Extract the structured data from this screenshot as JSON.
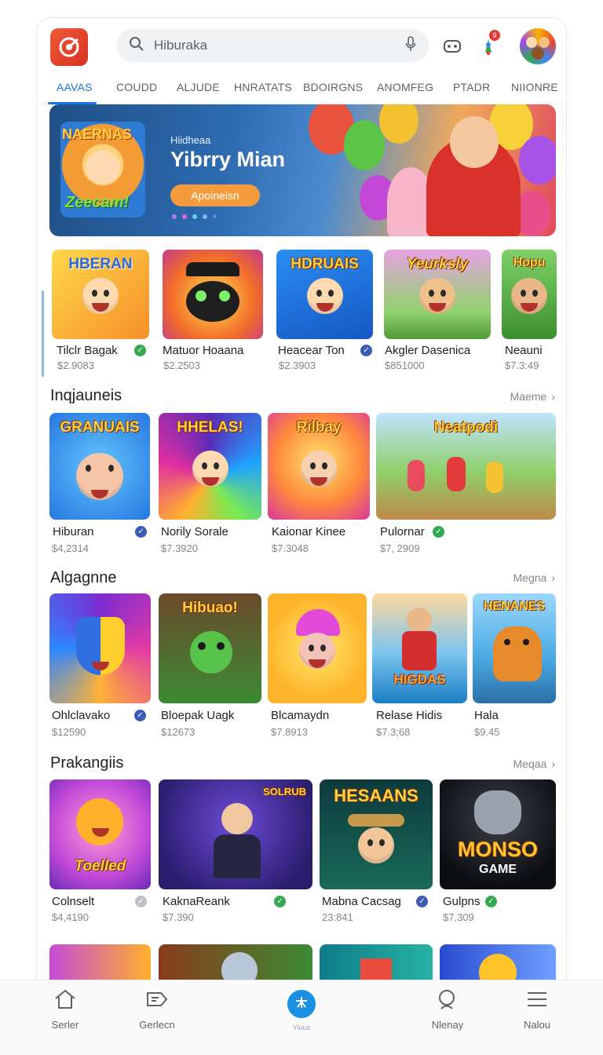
{
  "header": {
    "search_placeholder": "Hiburaka",
    "notification_count": "9"
  },
  "tabs": [
    "AAVAS",
    "COUDD",
    "ALJUDE",
    "HNRATATS",
    "BDOIRGNS",
    "ANOMFEG",
    "PTADR",
    "NIIONRE"
  ],
  "banner": {
    "logo_top": "NAERNAS",
    "logo_bottom": "Zeecam!",
    "kicker": "Hiidheaa",
    "title": "Yibrry Mian",
    "button_label": "Apoineisn"
  },
  "row1": [
    {
      "logo": "HBERAN",
      "name": "Tilclr Bagak",
      "price": "$2.9083",
      "badge": "green"
    },
    {
      "logo": "",
      "name": "Matuor Hoaana",
      "price": "$2.2503",
      "badge": ""
    },
    {
      "logo": "HDRUAIS",
      "name": "Heacear Ton",
      "price": "$2.3903",
      "badge": "blue"
    },
    {
      "logo": "Yeurksly",
      "name": "Akgler Dasenica",
      "price": "$851000",
      "badge": ""
    },
    {
      "logo": "Hopu",
      "name": "Neauni",
      "price": "$7.3:49",
      "badge": ""
    }
  ],
  "sections": [
    {
      "title": "Inqjauneis",
      "more": "Maeme",
      "items": [
        {
          "logo": "GRANUAIS",
          "name": "Hiburan",
          "price": "$4,2314",
          "badge": "blue"
        },
        {
          "logo": "HHELAS!",
          "name": "Norily Sorale",
          "price": "$7.3920",
          "badge": ""
        },
        {
          "logo": "Rilbay",
          "name": "Kaionar Kinee",
          "price": "$7.3048",
          "badge": ""
        },
        {
          "logo": "Neatpodi",
          "name": "Pulornar",
          "price": "$7, 2909",
          "badge": "green"
        }
      ]
    },
    {
      "title": "Algagnne",
      "more": "Megna",
      "items": [
        {
          "logo": "",
          "name": "Ohlclavako",
          "price": "$12590",
          "badge": "blue"
        },
        {
          "logo": "Hibuao!",
          "name": "Bloepak Uagk",
          "price": "$12673",
          "badge": ""
        },
        {
          "logo": "",
          "name": "Blcamaydn",
          "price": "$7.8913",
          "badge": ""
        },
        {
          "logo": "HIGDAS",
          "name": "Relase Hidis",
          "price": "$7.3;68",
          "badge": ""
        },
        {
          "logo": "HENANES",
          "name": "Hala",
          "price": "$9.45",
          "badge": ""
        }
      ]
    },
    {
      "title": "Prakangiis",
      "more": "Meqaa",
      "items": [
        {
          "logo": "Toelled",
          "name": "Colnselt",
          "price": "$4,4190",
          "badge": "gray"
        },
        {
          "logo": "SOLRUB",
          "name": "KaknaReank",
          "price": "$7.390",
          "badge": "green"
        },
        {
          "logo": "HESAANS",
          "name": "Mabna Cacsag",
          "price": "23:841",
          "badge": "blue"
        },
        {
          "logo": "MONSO",
          "name": "Gulpns",
          "price": "$7,309",
          "badge": "green"
        }
      ]
    }
  ],
  "extra_logo": "GAME",
  "bottom_nav": [
    {
      "label": "Serler",
      "icon": "home-icon"
    },
    {
      "label": "Gerlecn",
      "icon": "tag-icon"
    },
    {
      "label": "Yiuus",
      "icon": "apps-icon"
    },
    {
      "label": "Nlenay",
      "icon": "search-icon"
    },
    {
      "label": "Nalou",
      "icon": "menu-icon"
    }
  ],
  "colors": {
    "accent": "#1a73e8",
    "verified": "#34a853",
    "badge_blue": "#3c5bb5"
  }
}
